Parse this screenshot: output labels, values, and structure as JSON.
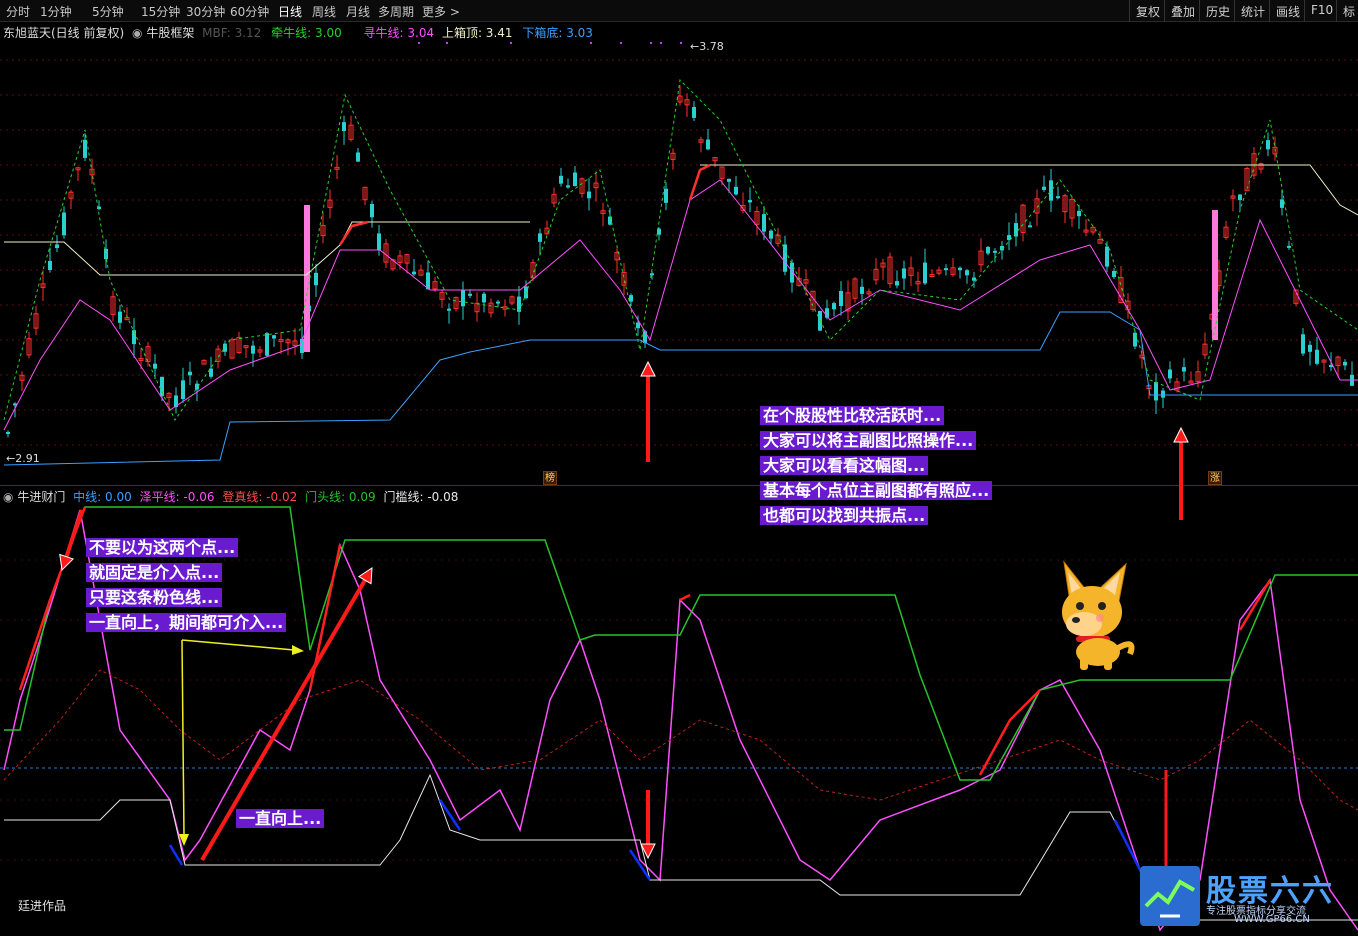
{
  "toolbar": {
    "periods": [
      "分时",
      "1分钟",
      "5分钟",
      "15分钟",
      "30分钟",
      "60分钟",
      "日线",
      "周线",
      "月线",
      "多周期",
      "更多 >"
    ],
    "active_period": "日线",
    "right_buttons": [
      "复权",
      "叠加",
      "历史",
      "统计",
      "画线",
      "F10",
      "标"
    ]
  },
  "main_chart": {
    "stock_title": "东旭蓝天(日线 前复权)",
    "indicator_name": "牛股框架",
    "mbf_label": "MBF: 3.12",
    "lines": [
      {
        "label": "牵牛线: 3.00",
        "color": "#26d12a"
      },
      {
        "label": "寻牛线: 3.04",
        "color": "#ff4fff"
      },
      {
        "label": "上箱顶: 3.41",
        "color": "#f0f0c8"
      },
      {
        "label": "下箱底: 3.03",
        "color": "#3aa0ff"
      }
    ],
    "high_label": "3.78",
    "low_label": "2.91",
    "tag_left": "榜",
    "tag_right": "涨"
  },
  "sub_chart": {
    "name": "牛进财门",
    "lines": [
      {
        "label": "中线: 0.00",
        "color": "#3aa0ff"
      },
      {
        "label": "泽平线: -0.06",
        "color": "#ff4fff"
      },
      {
        "label": "登真线: -0.02",
        "color": "#ff4a4a"
      },
      {
        "label": "门头线: 0.09",
        "color": "#26c22a"
      },
      {
        "label": "门槛线: -0.08",
        "color": "#e8e8e8"
      }
    ]
  },
  "annotations": {
    "right_note": [
      "在个股股性比较活跃时...",
      "大家可以将主副图比照操作...",
      "大家可以看看这幅图...",
      "基本每个点位主副图都有照应...",
      "也都可以找到共振点..."
    ],
    "left_note": [
      "不要以为这两个点...",
      "就固定是介入点...",
      "只要这条粉色线...",
      "一直向上，期间都可介入..."
    ],
    "up_note": "一直向上..."
  },
  "footer": "廷进作品",
  "watermark": {
    "title": "股票六六",
    "subtitle": "专注股票指标分享交流",
    "url": "WWW.GP66.CN"
  },
  "colors": {
    "up_candle": "#ff3030",
    "down_candle": "#2ad0d0",
    "annotation_bg": "#6a1bd0"
  }
}
